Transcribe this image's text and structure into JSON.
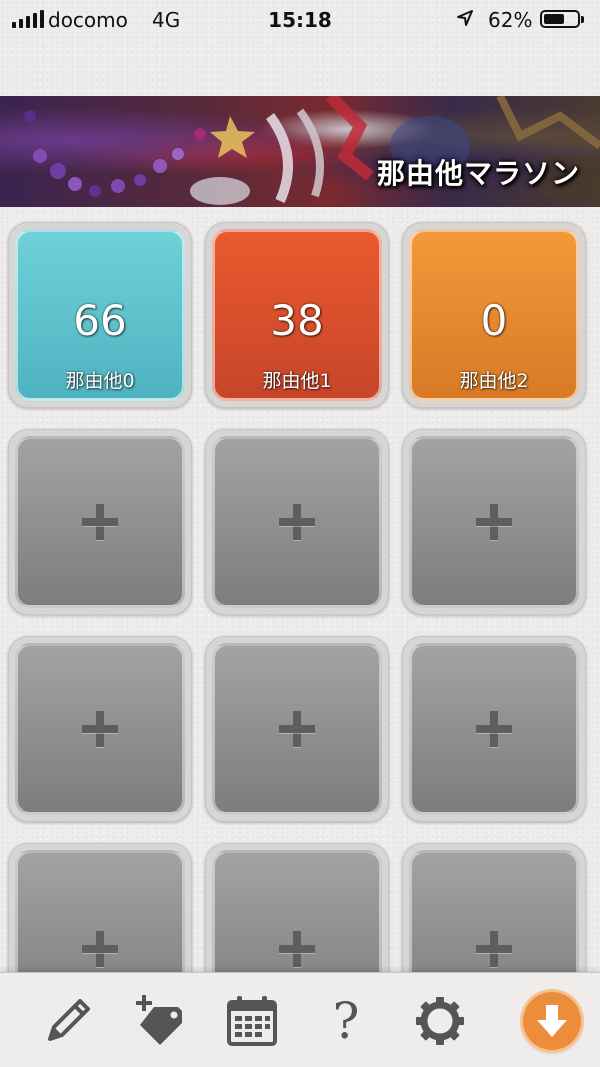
{
  "status_bar": {
    "carrier": "docomo",
    "network": "4G",
    "time": "15:18",
    "battery": "62%",
    "battery_level": 0.62
  },
  "banner": {
    "title": "那由他マラソン"
  },
  "counters": [
    {
      "count": "66",
      "label": "那由他0",
      "color": "#62c3cc"
    },
    {
      "count": "38",
      "label": "那由他1",
      "color": "#df5530"
    },
    {
      "count": "0",
      "label": "那由他2",
      "color": "#ec8d34"
    }
  ],
  "empty_slots_icon": "plus-icon",
  "toolbar": {
    "icons": [
      "pencil-icon",
      "tag-add-icon",
      "calendar-icon",
      "help-icon",
      "gear-icon",
      "download-icon"
    ],
    "help_glyph": "?"
  }
}
